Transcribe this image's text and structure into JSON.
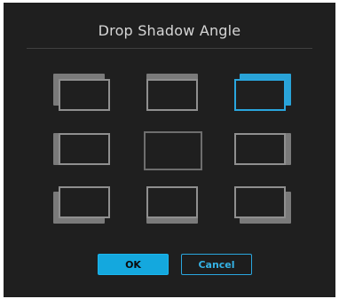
{
  "dialog": {
    "title": "Drop Shadow Angle",
    "selected_angle": "top-right",
    "angles": [
      {
        "id": "top-left",
        "selected": false
      },
      {
        "id": "top",
        "selected": false
      },
      {
        "id": "top-right",
        "selected": true
      },
      {
        "id": "left",
        "selected": false
      },
      {
        "id": "none",
        "selected": false
      },
      {
        "id": "right",
        "selected": false
      },
      {
        "id": "bottom-left",
        "selected": false
      },
      {
        "id": "bottom",
        "selected": false
      },
      {
        "id": "bottom-right",
        "selected": false
      }
    ],
    "ok_label": "OK",
    "cancel_label": "Cancel"
  },
  "colors": {
    "background": "#1f1f1f",
    "accent": "#2aa6de",
    "frame": "#8f8f8f",
    "shadow": "#7a7a7a"
  }
}
